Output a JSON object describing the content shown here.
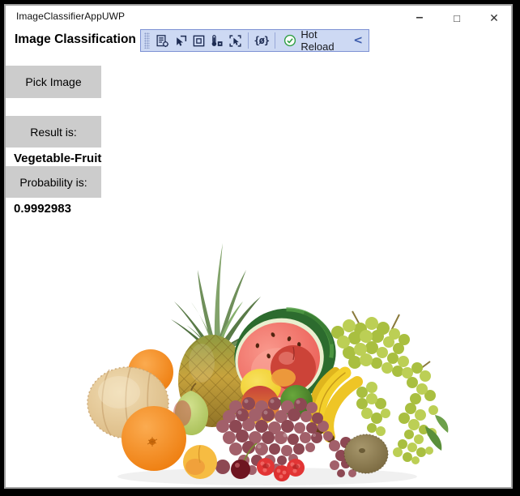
{
  "window": {
    "title": "ImageClassifierAppUWP",
    "minimize_glyph": "–",
    "maximize_glyph": "□",
    "close_glyph": "✕"
  },
  "app": {
    "heading": "Image Classification",
    "pick_image_button": "Pick Image",
    "result_label": "Result is:",
    "result_value": "Vegetable-Fruit",
    "probability_label": "Probability is:",
    "probability_value": "0.9992983",
    "photo_subject": "Assorted fresh fruit on white background: pineapple, cut watermelon, green and red grapes, bananas, cantaloupe melon, oranges, pear, lemon, nectarines, lime, apricot, cherry, raspberries and kiwi"
  },
  "debug_toolbar": {
    "icons": [
      {
        "name": "go-to-live-visual-tree-icon"
      },
      {
        "name": "enable-selection-icon"
      },
      {
        "name": "display-layout-adorners-icon"
      },
      {
        "name": "track-focused-element-icon"
      },
      {
        "name": "select-element-icon"
      },
      {
        "name": "show-code-icon",
        "glyph": "{ø}"
      }
    ],
    "hot_reload": {
      "label": "Hot Reload"
    },
    "chevron_glyph": "<"
  },
  "colors": {
    "toolbar_bg": "#cdd9f3",
    "toolbar_border": "#7e92d4",
    "button_bg": "#cccccc",
    "hot_reload_green": "#2f9e44",
    "chevron_blue": "#3b5bab",
    "frame_black": "#000000",
    "frame_gray": "#a3a3a3"
  }
}
